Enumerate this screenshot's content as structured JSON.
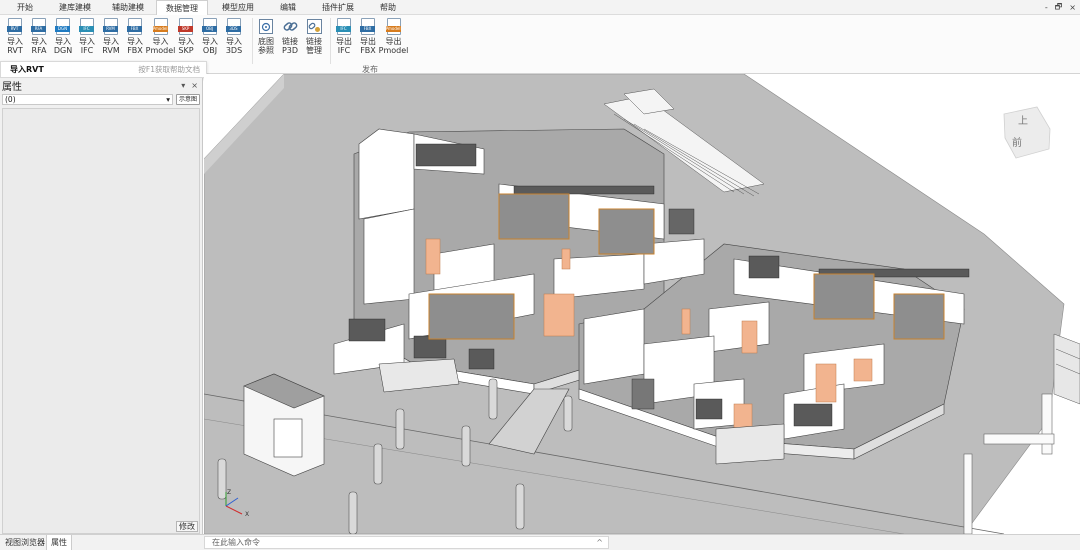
{
  "menu": {
    "tabs": [
      "开始",
      "建库建模",
      "辅助建模",
      "数据管理",
      "模型应用",
      "编辑",
      "插件扩展",
      "帮助"
    ],
    "active_index": 3,
    "window_minimize": "-",
    "window_restore": "🗗",
    "window_close": "×"
  },
  "ribbon": {
    "import_buttons": [
      {
        "tag": "RVT",
        "line1": "导入",
        "line2": "RVT",
        "color": "#2e6da4"
      },
      {
        "tag": "RFA",
        "line1": "导入",
        "line2": "RFA",
        "color": "#2e6da4"
      },
      {
        "tag": "DGN",
        "line1": "导入",
        "line2": "DGN",
        "color": "#1f7bc2"
      },
      {
        "tag": "IFC",
        "line1": "导入",
        "line2": "IFC",
        "color": "#2a8fb5"
      },
      {
        "tag": "RVM",
        "line1": "导入",
        "line2": "RVM",
        "color": "#2e6da4"
      },
      {
        "tag": "FBX",
        "line1": "导入",
        "line2": "FBX",
        "color": "#2e6da4"
      },
      {
        "tag": "Pmodel",
        "line1": "导入",
        "line2": "Pmodel",
        "color": "#d77c1e"
      },
      {
        "tag": "SKP",
        "line1": "导入",
        "line2": "SKP",
        "color": "#c0392b"
      },
      {
        "tag": "OBJ",
        "line1": "导入",
        "line2": "OBJ",
        "color": "#2e6da4"
      },
      {
        "tag": "3DS",
        "line1": "导入",
        "line2": "3DS",
        "color": "#2e6da4"
      }
    ],
    "tool_buttons": [
      {
        "icon": "base-map-icon",
        "line1": "底图",
        "line2": "参照"
      },
      {
        "icon": "link-icon",
        "line1": "链接",
        "line2": "P3D"
      },
      {
        "icon": "link-manage-icon",
        "line1": "链接",
        "line2": "管理"
      }
    ],
    "export_buttons": [
      {
        "tag": "IFC",
        "line1": "导出",
        "line2": "IFC",
        "color": "#2a8fb5"
      },
      {
        "tag": "FBX",
        "line1": "导出",
        "line2": "FBX",
        "color": "#2e6da4"
      },
      {
        "tag": "Pmodel",
        "line1": "导出",
        "line2": "Pmodel",
        "color": "#d77c1e"
      }
    ],
    "publish_caption": "发布"
  },
  "tooltip": {
    "title": "导入RVT",
    "hint": "按F1获取帮助文档"
  },
  "panel": {
    "title": "属性",
    "pin": "▾",
    "close": "×",
    "selector_value": "(0)",
    "selector_arrow": "▾",
    "small_button": "示意图",
    "modify_button": "修改"
  },
  "bottom": {
    "tabs": [
      "视图浏览器",
      "属性"
    ],
    "active_index": 1,
    "command_placeholder": "在此输入命令",
    "command_arrow": "^"
  },
  "viewcube": {
    "top_label": "上",
    "front_label": "前"
  },
  "axes": {
    "x": "X",
    "z": "Z"
  }
}
